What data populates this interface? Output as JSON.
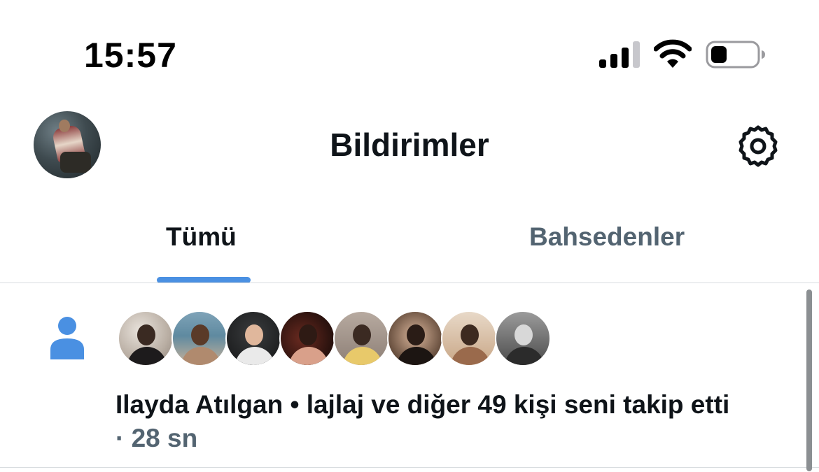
{
  "status_bar": {
    "time": "15:57"
  },
  "header": {
    "title": "Bildirimler"
  },
  "tabs": [
    {
      "label": "Tümü",
      "active": true
    },
    {
      "label": "Bahsedenler",
      "active": false
    }
  ],
  "notification": {
    "type_icon": "person-icon",
    "text": "Ilayda Atılgan • lajlaj ve diğer 49 kişi seni takip etti",
    "time": "· 28 sn",
    "follower_avatar_count": 8
  },
  "colors": {
    "accent": "#4a90e2",
    "text_primary": "#0f1419",
    "text_secondary": "#536471",
    "divider": "#d9dde0"
  }
}
